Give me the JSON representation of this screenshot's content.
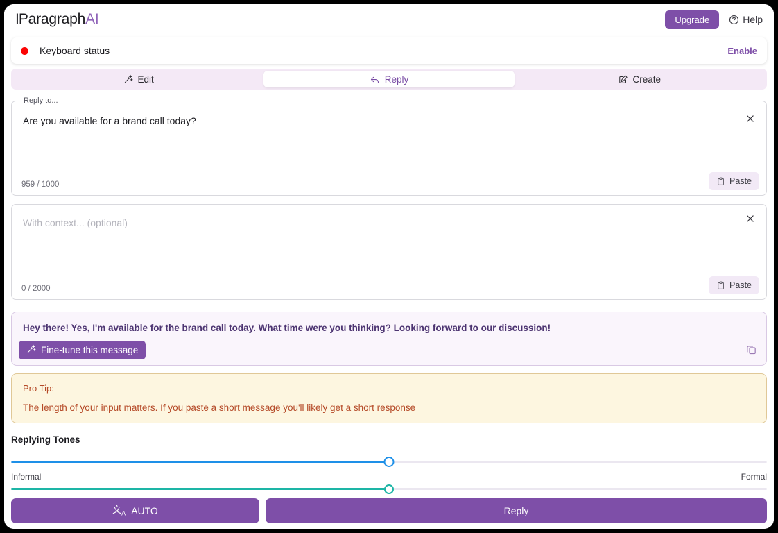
{
  "header": {
    "brand_main": "Paragraph",
    "brand_accent": "AI",
    "upgrade_label": "Upgrade",
    "help_label": "Help"
  },
  "keyboard_status": {
    "label": "Keyboard status",
    "enable_label": "Enable",
    "status_color": "#fb0505"
  },
  "tabs": [
    {
      "label": "Edit",
      "icon": "magic-wand-icon",
      "active": false
    },
    {
      "label": "Reply",
      "icon": "reply-arrow-icon",
      "active": true
    },
    {
      "label": "Create",
      "icon": "pencil-square-icon",
      "active": false
    }
  ],
  "reply_to": {
    "legend": "Reply to...",
    "value": "Are you available for a brand call today?",
    "counter": "959 / 1000",
    "paste_label": "Paste"
  },
  "context": {
    "placeholder": "With context... (optional)",
    "value": "",
    "counter": "0 / 2000",
    "paste_label": "Paste"
  },
  "result": {
    "message": "Hey there! Yes, I'm available for the brand call today. What time were you thinking? Looking forward to our discussion!",
    "finetune_label": "Fine-tune this message"
  },
  "pro_tip": {
    "title": "Pro Tip:",
    "body": "The length of your input matters. If you paste a short message you'll likely get a short response"
  },
  "tones": {
    "title": "Replying Tones",
    "left_label": "Informal",
    "right_label": "Formal",
    "value_percent": 50,
    "second_value_percent": 50,
    "accent": "#1e90e8"
  },
  "footer": {
    "auto_label": "AUTO",
    "reply_label": "Reply"
  }
}
